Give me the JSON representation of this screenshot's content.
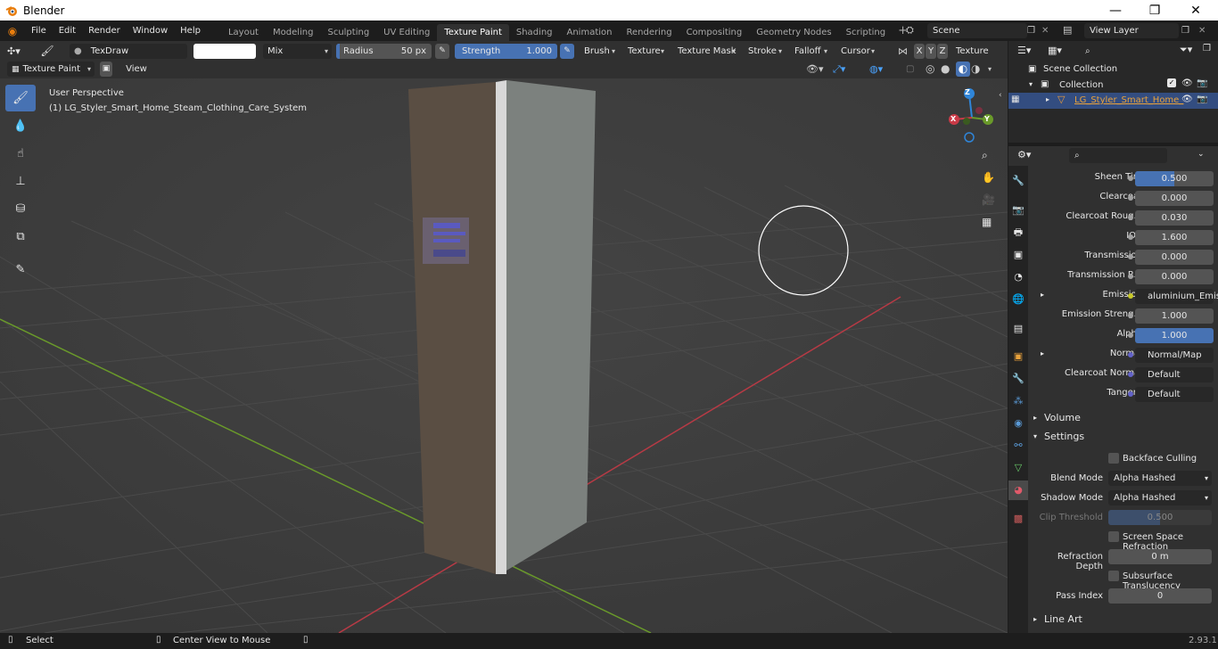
{
  "window": {
    "title": "Blender",
    "minimize": "—",
    "maximize": "❐",
    "close": "✕"
  },
  "menus": [
    "File",
    "Edit",
    "Render",
    "Window",
    "Help"
  ],
  "workspace_tabs": [
    "Layout",
    "Modeling",
    "Sculpting",
    "UV Editing",
    "Texture Paint",
    "Shading",
    "Animation",
    "Rendering",
    "Compositing",
    "Geometry Nodes",
    "Scripting"
  ],
  "active_tab": "Texture Paint",
  "scene": {
    "name": "Scene",
    "view_layer": "View Layer"
  },
  "toolheader": {
    "brush_name": "TexDraw",
    "blend": "Mix",
    "radius_label": "Radius",
    "radius_value": "50 px",
    "strength_label": "Strength",
    "strength_value": "1.000",
    "menus": [
      "Brush",
      "Texture",
      "Texture Mask",
      "Stroke",
      "Falloff",
      "Cursor"
    ],
    "axes": [
      "X",
      "Y",
      "Z"
    ],
    "texture_slots": "Texture Slots"
  },
  "viewheader": {
    "mode": "Texture Paint",
    "view": "View"
  },
  "viewport": {
    "perspective": "User Perspective",
    "object": "(1) LG_Styler_Smart_Home_Steam_Clothing_Care_System"
  },
  "gizmo": {
    "x": "X",
    "y": "Y",
    "z": "Z"
  },
  "outliner": {
    "scene_collection": "Scene Collection",
    "collection": "Collection",
    "object": "LG_Styler_Smart_Home_"
  },
  "properties": {
    "rows": [
      {
        "label": "Sheen Tint",
        "value": "0.500",
        "style": "blue-half"
      },
      {
        "label": "Clearcoat",
        "value": "0.000",
        "style": "plain"
      },
      {
        "label": "Clearcoat Roug...",
        "value": "0.030",
        "style": "plain"
      },
      {
        "label": "IOR",
        "value": "1.600",
        "style": "plain"
      },
      {
        "label": "Transmission",
        "value": "0.000",
        "style": "plain"
      },
      {
        "label": "Transmission R...",
        "value": "0.000",
        "style": "plain"
      },
      {
        "label": "Emission",
        "value": "aluminium_Emissive...",
        "style": "link"
      },
      {
        "label": "Emission Streng...",
        "value": "1.000",
        "style": "plain"
      },
      {
        "label": "Alpha",
        "value": "1.000",
        "style": "blue"
      },
      {
        "label": "Normal",
        "value": "Normal/Map",
        "style": "link"
      },
      {
        "label": "Clearcoat Normal",
        "value": "Default",
        "style": "link"
      },
      {
        "label": "Tangent",
        "value": "Default",
        "style": "link"
      }
    ],
    "volume": "Volume",
    "settings": "Settings",
    "backface_culling": "Backface Culling",
    "blend_mode_label": "Blend Mode",
    "blend_mode": "Alpha Hashed",
    "shadow_mode_label": "Shadow Mode",
    "shadow_mode": "Alpha Hashed",
    "clip_label": "Clip Threshold",
    "clip_value": "0.500",
    "ssr": "Screen Space Refraction",
    "refraction_label": "Refraction Depth",
    "refraction_value": "0 m",
    "subsurface": "Subsurface Translucency",
    "pass_label": "Pass Index",
    "pass_value": "0",
    "line_art": "Line Art"
  },
  "status": {
    "select": "Select",
    "center": "Center View to Mouse",
    "version": "2.93.1"
  },
  "colors": {
    "accent": "#4772b3",
    "x_axis": "#c93a47",
    "y_axis": "#6a9a2a",
    "z_axis": "#2f85d8"
  }
}
